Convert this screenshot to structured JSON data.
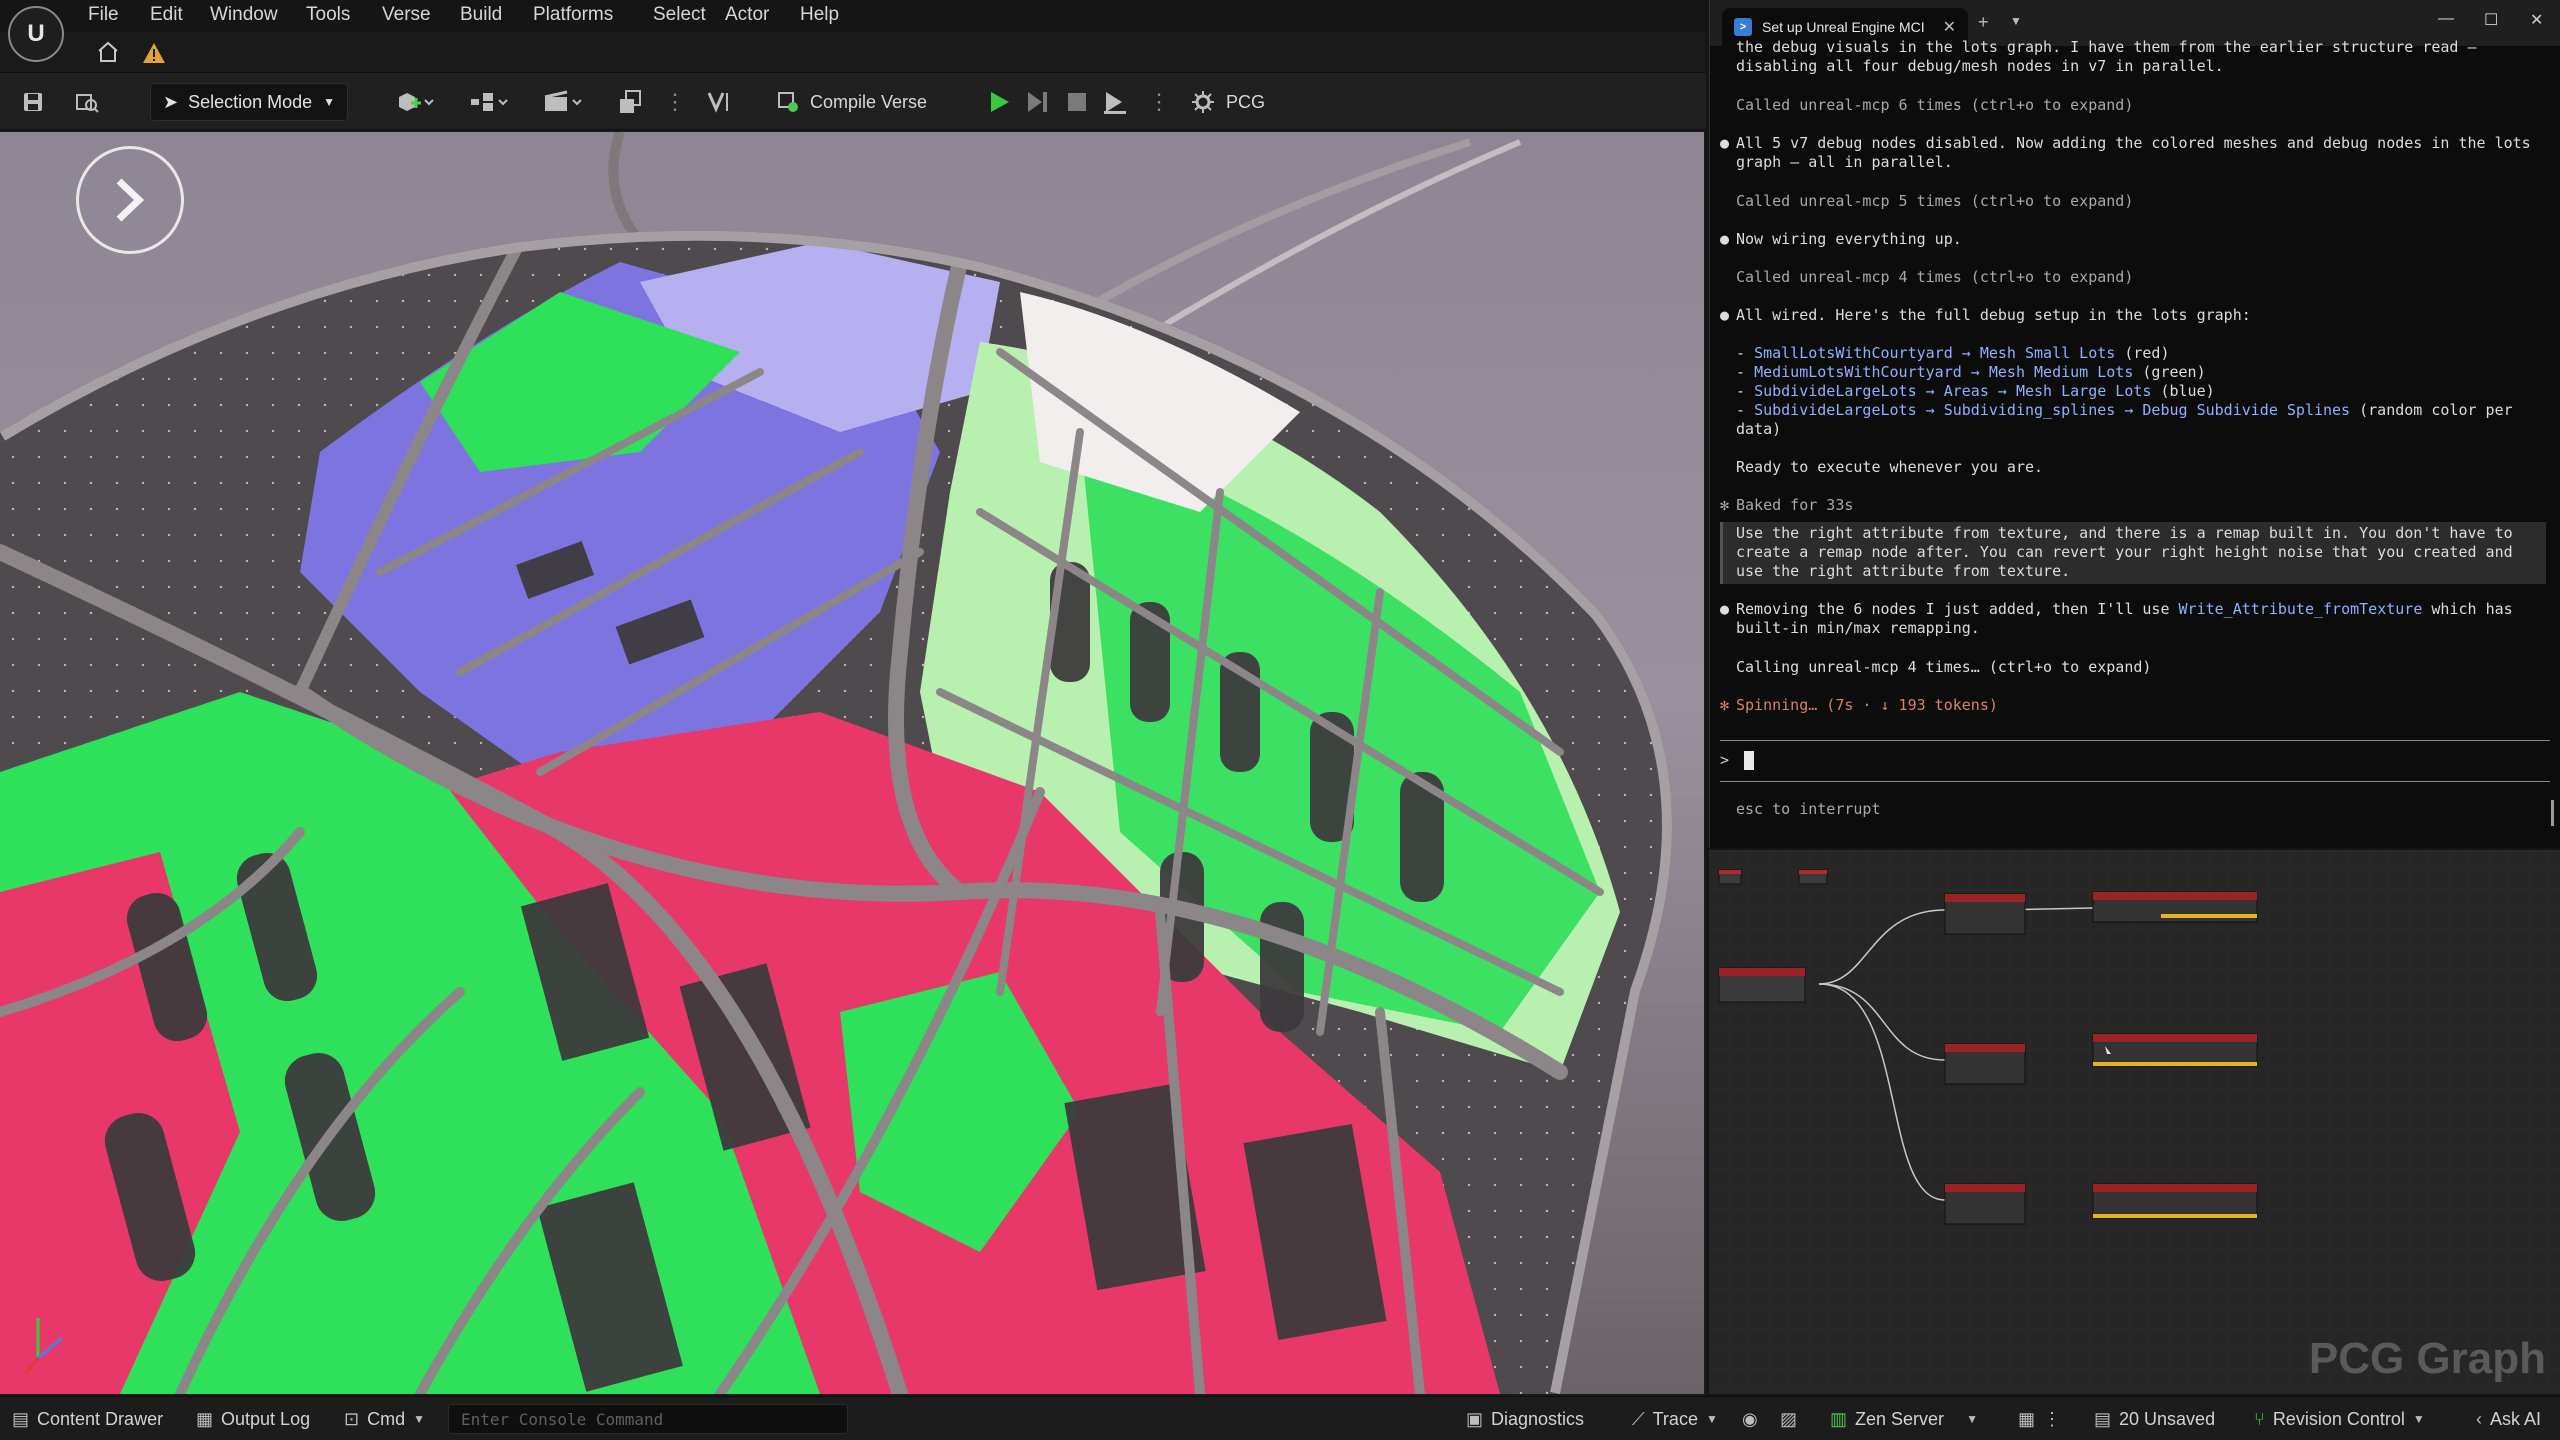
{
  "menu": [
    "File",
    "Edit",
    "Window",
    "Tools",
    "Verse",
    "Build",
    "Platforms",
    "Select",
    "Actor",
    "Help"
  ],
  "toolbar": {
    "selection_mode": "Selection Mode",
    "compile_verse": "Compile Verse",
    "pcg": "PCG"
  },
  "statusbar": {
    "content_drawer": "Content Drawer",
    "output_log": "Output Log",
    "cmd": "Cmd",
    "console_placeholder": "Enter Console Command",
    "diagnostics": "Diagnostics",
    "trace": "Trace",
    "zen_server": "Zen Server",
    "unsaved": "20 Unsaved",
    "revision_control": "Revision Control",
    "ask_ai": "Ask AI"
  },
  "terminal": {
    "tab_title": "Set up Unreal Engine MCI",
    "lines": {
      "l1": "the debug visuals in the lots graph. I have them from the earlier structure read –",
      "l2": "disabling all four debug/mesh nodes in v7 in parallel.",
      "l3": "Called unreal-mcp 6 times (ctrl+o to expand)",
      "l4": "All 5 v7 debug nodes disabled. Now adding the colored meshes and debug nodes in the lots",
      "l5": "graph – all in parallel.",
      "l6": "Called unreal-mcp 5 times (ctrl+o to expand)",
      "l7": "Now wiring everything up.",
      "l8": "Called unreal-mcp 4 times (ctrl+o to expand)",
      "l9": "All wired. Here's the full debug setup in the lots graph:",
      "l10a": "SmallLotsWithCourtyard → Mesh Small Lots",
      "l10b": " (red)",
      "l11a": "MediumLotsWithCourtyard → Mesh Medium Lots",
      "l11b": " (green)",
      "l12a": "SubdivideLargeLots → Areas → Mesh Large Lots",
      "l12b": " (blue)",
      "l13a": "SubdivideLargeLots → Subdividing_splines → Debug Subdivide Splines",
      "l13b": " (random color per",
      "l14": "data)",
      "l15": "Ready to execute whenever you are.",
      "l16": "Baked for 33s",
      "l17": "Use the right attribute from texture, and there is a remap built in. You don't have to",
      "l18": "create a remap node after. You can revert your right height noise that you created and",
      "l19": "use the right attribute from texture.",
      "l20a": "Removing the 6 nodes I just added, then I'll use ",
      "l20b": "Write_Attribute_fromTexture",
      "l20c": " which has",
      "l21": "built-in min/max remapping.",
      "l22": "Calling unreal-mcp 4 times… (ctrl+o to expand)",
      "l23": "Spinning… (7s · ↓ 193 tokens)",
      "esc": "esc to interrupt"
    }
  },
  "pcg_graph": {
    "title": "PCG Graph"
  },
  "colors": {
    "lot_red": "#e8386a",
    "lot_green": "#2fe05a",
    "lot_light_green": "#b8f0b0",
    "lot_blue": "#7d74e0",
    "lot_lavender": "#b7b0f0",
    "road": "#8c8688"
  },
  "icons": {
    "play_overlay": "chevron-right-icon",
    "spinner": "asterisk-icon"
  }
}
